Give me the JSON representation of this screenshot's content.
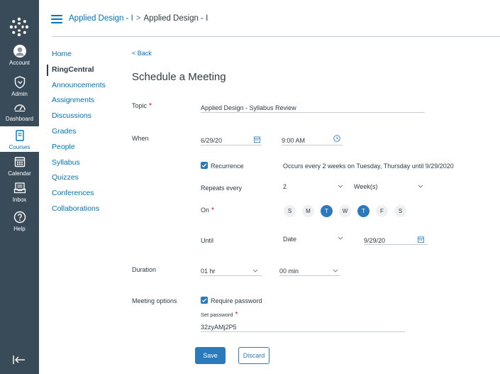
{
  "global_nav": {
    "items": [
      {
        "label": "Account",
        "icon": "avatar-icon"
      },
      {
        "label": "Admin",
        "icon": "shield-icon"
      },
      {
        "label": "Dashboard",
        "icon": "dashboard-icon"
      },
      {
        "label": "Courses",
        "icon": "book-icon"
      },
      {
        "label": "Calendar",
        "icon": "calendar-icon"
      },
      {
        "label": "Inbox",
        "icon": "inbox-icon"
      },
      {
        "label": "Help",
        "icon": "help-icon"
      }
    ],
    "active": "Courses",
    "accent": "#394b58"
  },
  "breadcrumb": {
    "course_link": "Applied Design - I",
    "separator": ">",
    "current": "Applied Design - I"
  },
  "course_nav": {
    "items": [
      "Home",
      "RingCentral",
      "Announcements",
      "Assignments",
      "Discussions",
      "Grades",
      "People",
      "Syllabus",
      "Quizzes",
      "Conferences",
      "Collaborations"
    ],
    "active": "RingCentral"
  },
  "form": {
    "back_label": "< Back",
    "title": "Schedule a Meeting",
    "topic_label": "Topic",
    "topic_value": "Applied Design - Syllabus Review",
    "required_mark": "*",
    "when_label": "When",
    "date_value": "6/29/20",
    "time_value": "9:00 AM",
    "recurrence_label": "Recurrence",
    "recurrence_summary": "Occurs every 2 weeks on Tuesday, Thursday until 9/29/2020",
    "repeats_label": "Repeats every",
    "repeats_value": "2",
    "repeats_unit": "Week(s)",
    "on_label": "On",
    "days": [
      {
        "label": "S",
        "selected": false
      },
      {
        "label": "M",
        "selected": false
      },
      {
        "label": "T",
        "selected": true
      },
      {
        "label": "W",
        "selected": false
      },
      {
        "label": "T",
        "selected": true
      },
      {
        "label": "F",
        "selected": false
      },
      {
        "label": "S",
        "selected": false
      }
    ],
    "until_label": "Until",
    "until_type": "Date",
    "until_date": "9/29/20",
    "duration_label": "Duration",
    "duration_hours": "01 hr",
    "duration_minutes": "00 min",
    "meeting_options_label": "Meeting options",
    "require_password_label": "Require password",
    "set_password_label": "Set password",
    "password_value": "32zyAMj2P5",
    "save_label": "Save",
    "discard_label": "Discard"
  },
  "colors": {
    "primary": "#2b7abc",
    "link": "#0374b5",
    "required": "#e0061f"
  }
}
